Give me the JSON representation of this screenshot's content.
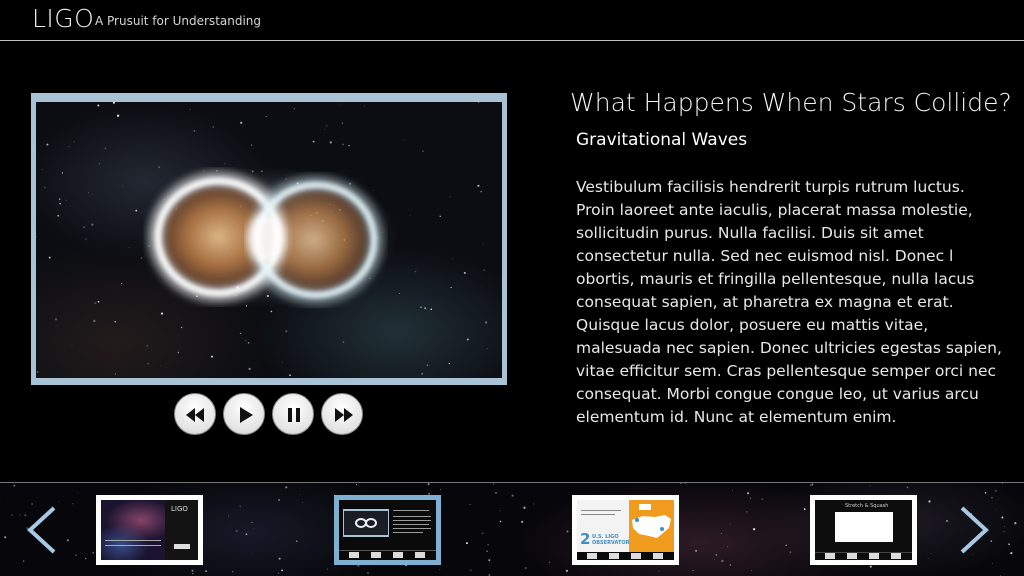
{
  "header": {
    "logo": "LIGO",
    "tagline": "A Prusuit for Understanding"
  },
  "video": {
    "controls": [
      {
        "name": "rewind-button",
        "icon": "rewind-icon"
      },
      {
        "name": "play-button",
        "icon": "play-icon"
      },
      {
        "name": "pause-button",
        "icon": "pause-icon"
      },
      {
        "name": "fast-forward-button",
        "icon": "fast-forward-icon"
      }
    ]
  },
  "article": {
    "title": "What Happens When Stars Collide?",
    "subtitle": "Gravitational Waves",
    "body": "Vestibulum facilisis hendrerit turpis rutrum luctus. Proin laoreet ante iaculis, placerat massa molestie, sollicitudin purus. Nulla facilisi. Duis sit amet consectetur nulla. Sed nec euismod nisl. Donec l obortis, mauris et fringilla pellentesque, nulla lacus consequat sapien, at pharetra ex magna et erat. Quisque lacus dolor, posuere eu mattis vitae, malesuada nec sapien. Donec ultricies egestas sapien, vitae efficitur sem. Cras pellentesque semper  orci nec consequat. Morbi congue congue leo, ut varius arcu elementum id. Nunc at elementum enim."
  },
  "filmstrip": {
    "prev_icon": "chevron-left-icon",
    "next_icon": "chevron-right-icon",
    "active_index": 1,
    "thumbnails": [
      {
        "logo": "LIGO"
      },
      {},
      {
        "number": "2",
        "label_line1": "U.S. LIGO",
        "label_line2": "OBSERVATORIES"
      },
      {
        "title": "Stretch & Squash"
      }
    ]
  },
  "colors": {
    "frame": "#a9c3d6",
    "active_thumb": "#7fb0d1",
    "arrow": "#a9c8e4",
    "map_orange": "#f09a1e"
  }
}
